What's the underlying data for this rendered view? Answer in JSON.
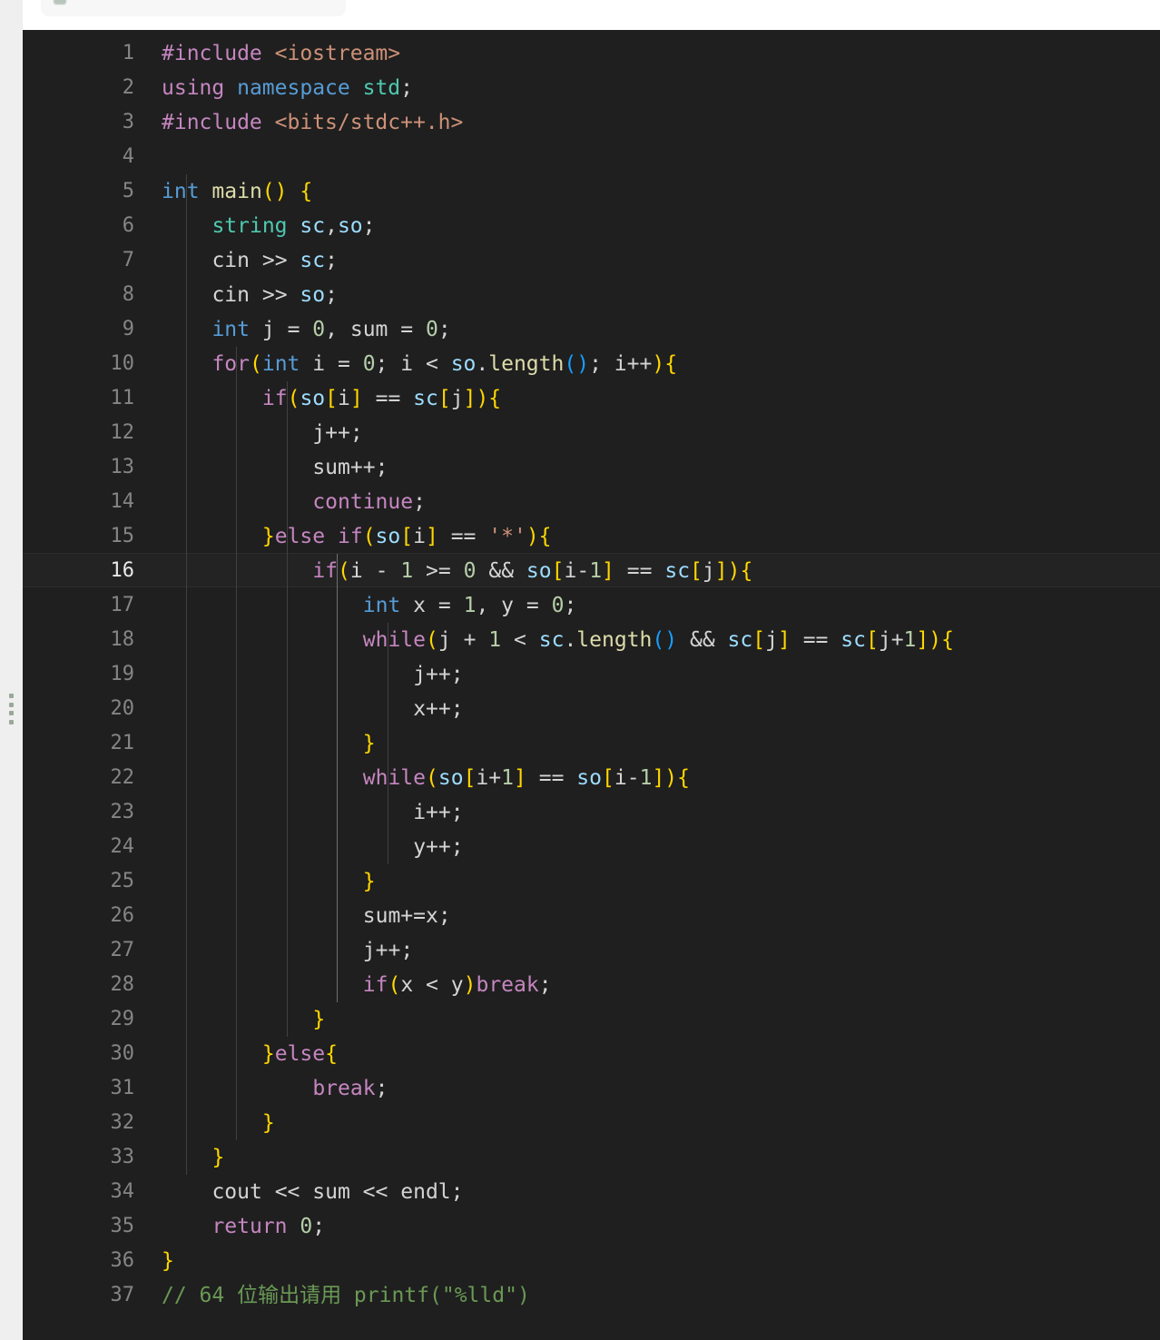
{
  "window": {
    "background_color": "#ffffff",
    "gutter_color": "#efefef",
    "editor_background": "#1f1f1f"
  },
  "top_card": {
    "name": "partial-card",
    "background_color": "#f7f7f7",
    "icon": "avatar-icon"
  },
  "drag_handle": {
    "name": "panel-drag-handle",
    "dots": 4
  },
  "editor": {
    "language": "cpp",
    "theme": "dark-plus",
    "active_line": 16,
    "tab_size": 4,
    "first_visible_line": 1,
    "last_visible_line": 37,
    "line_number_color": "#858585",
    "active_line_number_color": "#e8e8e8",
    "active_line_background": "#232323"
  },
  "code": {
    "lines": [
      {
        "n": "1",
        "text": "#include <iostream>"
      },
      {
        "n": "2",
        "text": "using namespace std;"
      },
      {
        "n": "3",
        "text": "#include <bits/stdc++.h>"
      },
      {
        "n": "4",
        "text": ""
      },
      {
        "n": "5",
        "text": "int main() {"
      },
      {
        "n": "6",
        "text": "    string sc,so;"
      },
      {
        "n": "7",
        "text": "    cin >> sc;"
      },
      {
        "n": "8",
        "text": "    cin >> so;"
      },
      {
        "n": "9",
        "text": "    int j = 0, sum = 0;"
      },
      {
        "n": "10",
        "text": "    for(int i = 0; i < so.length(); i++){"
      },
      {
        "n": "11",
        "text": "        if(so[i] == sc[j]){"
      },
      {
        "n": "12",
        "text": "            j++;"
      },
      {
        "n": "13",
        "text": "            sum++;"
      },
      {
        "n": "14",
        "text": "            continue;"
      },
      {
        "n": "15",
        "text": "        }else if(so[i] == '*'){"
      },
      {
        "n": "16",
        "text": "            if(i - 1 >= 0 && so[i-1] == sc[j]){"
      },
      {
        "n": "17",
        "text": "                int x = 1, y = 0;"
      },
      {
        "n": "18",
        "text": "                while(j + 1 < sc.length() && sc[j] == sc[j+1]){"
      },
      {
        "n": "19",
        "text": "                    j++;"
      },
      {
        "n": "20",
        "text": "                    x++;"
      },
      {
        "n": "21",
        "text": "                }"
      },
      {
        "n": "22",
        "text": "                while(so[i+1] == so[i-1]){"
      },
      {
        "n": "23",
        "text": "                    i++;"
      },
      {
        "n": "24",
        "text": "                    y++;"
      },
      {
        "n": "25",
        "text": "                }"
      },
      {
        "n": "26",
        "text": "                sum+=x;"
      },
      {
        "n": "27",
        "text": "                j++;"
      },
      {
        "n": "28",
        "text": "                if(x < y)break;"
      },
      {
        "n": "29",
        "text": "            }"
      },
      {
        "n": "30",
        "text": "        }else{"
      },
      {
        "n": "31",
        "text": "            break;"
      },
      {
        "n": "32",
        "text": "        }"
      },
      {
        "n": "33",
        "text": "    }"
      },
      {
        "n": "34",
        "text": "    cout << sum << endl;"
      },
      {
        "n": "35",
        "text": "    return 0;"
      },
      {
        "n": "36",
        "text": "}"
      },
      {
        "n": "37",
        "text": "// 64 位输出请用 printf(\"%lld\")"
      }
    ]
  },
  "syntax_colors": {
    "keyword": "#c586c0",
    "type": "#569cd6",
    "class": "#4ec9b0",
    "number": "#b5cea8",
    "string": "#ce9178",
    "variable": "#9cdcfe",
    "function": "#dcdcaa",
    "comment": "#6a9955",
    "text": "#d4d4d4",
    "bracket_level_1": "#ffd700",
    "bracket_level_2": "#da70d6",
    "bracket_level_3": "#179fff"
  }
}
